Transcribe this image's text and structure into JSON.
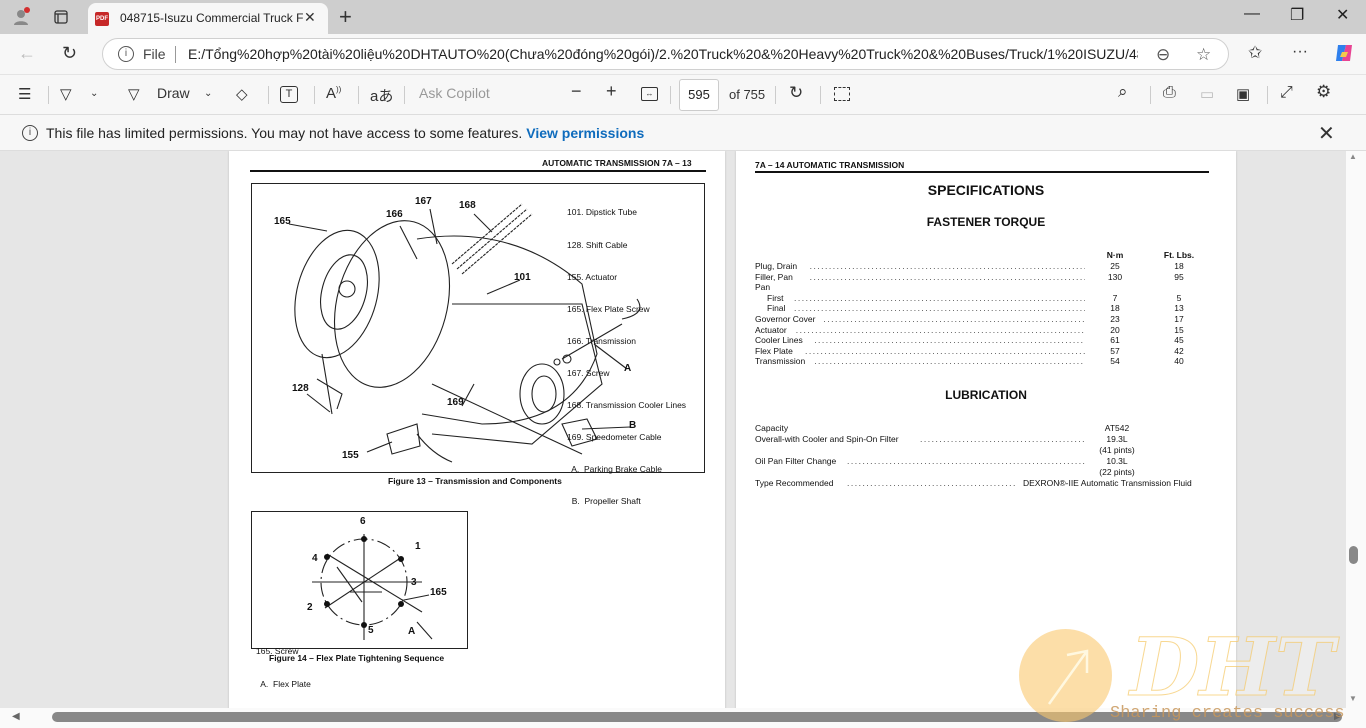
{
  "browser": {
    "tab_title": "048715-Isuzu Commercial Truck F",
    "new_tab": "+",
    "address_scheme": "File",
    "url": "E:/Tổng%20hợp%20tài%20liệu%20DHTAUTO%20(Chưa%20đóng%20gói)/2.%20Truck%20&%20Heavy%20Truck%20&%20Buses/Truck/1%20ISUZU/4871..."
  },
  "pdf_toolbar": {
    "draw_label": "Draw",
    "ask_copilot": "Ask Copilot",
    "current_page": "595",
    "page_total": "of 755"
  },
  "permissions_bar": {
    "message": "This file has limited permissions. You may not have access to some features.",
    "link": "View permissions"
  },
  "left_page": {
    "header": "AUTOMATIC TRANSMISSION  7A – 13",
    "figure13": {
      "callouts": [
        "165",
        "166",
        "167",
        "168",
        "101",
        "128",
        "169",
        "155",
        "A",
        "B"
      ],
      "legend": [
        "101. Dipstick Tube",
        "128. Shift Cable",
        "155. Actuator",
        "165. Flex Plate Screw",
        "166. Transmission",
        "167. Screw",
        "168. Transmission Cooler Lines",
        "169. Speedometer Cable",
        "  A.  Parking Brake Cable",
        "  B.  Propeller Shaft"
      ],
      "caption": "Figure 13 – Transmission and Components"
    },
    "figure14": {
      "numbers": [
        "6",
        "1",
        "4",
        "3",
        "165",
        "2",
        "5",
        "A"
      ],
      "legend": [
        "165. Screw",
        "  A.  Flex Plate"
      ],
      "caption": "Figure 14 – Flex Plate Tightening Sequence"
    }
  },
  "right_page": {
    "header": "7A – 14  AUTOMATIC TRANSMISSION",
    "title": "SPECIFICATIONS",
    "torque": {
      "title": "FASTENER TORQUE",
      "col1": "N·m",
      "col2": "Ft. Lbs.",
      "rows": [
        {
          "label": "Plug, Drain",
          "nm": "25",
          "ft": "18"
        },
        {
          "label": "Filler, Pan",
          "nm": "130",
          "ft": "95"
        },
        {
          "label": "Pan",
          "nm": "",
          "ft": ""
        },
        {
          "label": "First",
          "nm": "7",
          "ft": "5",
          "indent": true
        },
        {
          "label": "Final",
          "nm": "18",
          "ft": "13",
          "indent": true
        },
        {
          "label": "Governor Cover",
          "nm": "23",
          "ft": "17"
        },
        {
          "label": "Actuator",
          "nm": "20",
          "ft": "15"
        },
        {
          "label": "Cooler Lines",
          "nm": "61",
          "ft": "45"
        },
        {
          "label": "Flex Plate",
          "nm": "57",
          "ft": "42"
        },
        {
          "label": "Transmission",
          "nm": "54",
          "ft": "40"
        }
      ]
    },
    "lubrication": {
      "title": "LUBRICATION",
      "capacity_label": "Capacity",
      "model": "AT542",
      "overall_label": "Overall-with Cooler and Spin-On Filter",
      "overall_value": "19.3L",
      "overall_pints": "(41 pints)",
      "oilpan_label": "Oil Pan Filter Change",
      "oilpan_value": "10.3L",
      "oilpan_pints": "(22 pints)",
      "type_label": "Type Recommended",
      "type_value": "DEXRON®-IIE Automatic Transmission Fluid"
    }
  },
  "watermark": {
    "brand": "DHT",
    "tagline": "Sharing creates success"
  }
}
